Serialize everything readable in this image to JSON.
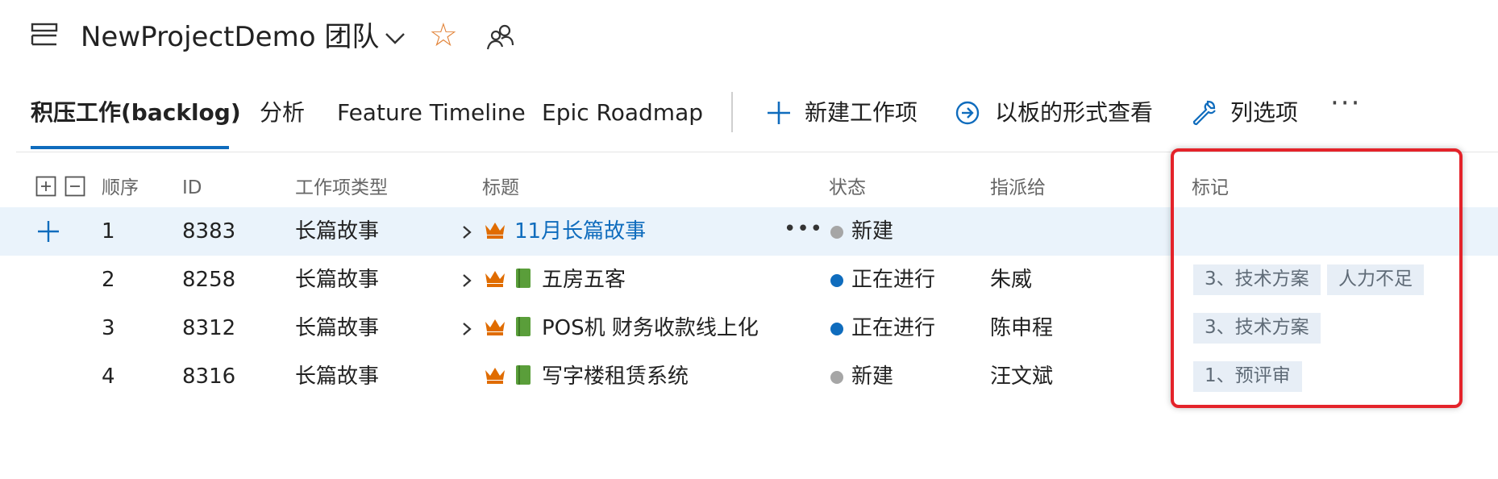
{
  "header": {
    "title": "NewProjectDemo 团队"
  },
  "tabs": [
    {
      "label": "积压工作(backlog)",
      "active": true
    },
    {
      "label": "分析",
      "active": false
    },
    {
      "label": "Feature Timeline",
      "active": false
    },
    {
      "label": "Epic Roadmap",
      "active": false
    }
  ],
  "actions": {
    "new_item": "新建工作项",
    "board_view": "以板的形式查看",
    "column_options": "列选项",
    "more": "···"
  },
  "table": {
    "columns": {
      "order": "顺序",
      "id": "ID",
      "type": "工作项类型",
      "title": "标题",
      "state": "状态",
      "assigned": "指派给",
      "tags": "标记"
    },
    "rows": [
      {
        "order": "1",
        "id": "8383",
        "type": "长篇故事",
        "title": "11月长篇故事",
        "state": "新建",
        "state_color": "#a6a6a6",
        "assigned": "",
        "tags": [],
        "selected": true,
        "expandable": true,
        "has_book": false
      },
      {
        "order": "2",
        "id": "8258",
        "type": "长篇故事",
        "title": "五房五客",
        "state": "正在进行",
        "state_color": "#0f6cbd",
        "assigned": "朱威",
        "tags": [
          "3、技术方案",
          "人力不足"
        ],
        "selected": false,
        "expandable": true,
        "has_book": true
      },
      {
        "order": "3",
        "id": "8312",
        "type": "长篇故事",
        "title": "POS机 财务收款线上化",
        "state": "正在进行",
        "state_color": "#0f6cbd",
        "assigned": "陈申程",
        "tags": [
          "3、技术方案"
        ],
        "selected": false,
        "expandable": true,
        "has_book": true
      },
      {
        "order": "4",
        "id": "8316",
        "type": "长篇故事",
        "title": "写字楼租赁系统",
        "state": "新建",
        "state_color": "#a6a6a6",
        "assigned": "汪文斌",
        "tags": [
          "1、预评审"
        ],
        "selected": false,
        "expandable": false,
        "has_book": true
      }
    ]
  },
  "colors": {
    "accent": "#0f6cbd",
    "selected_row": "#eaf3fb",
    "highlight": "#e4232a",
    "epic_icon": "#e06c00",
    "book_icon": "#5a9e3a"
  }
}
